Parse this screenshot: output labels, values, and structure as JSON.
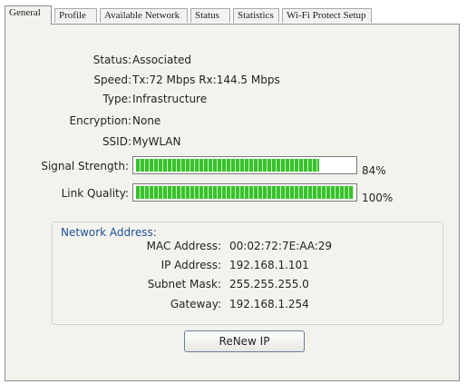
{
  "tabs": [
    {
      "label": "General"
    },
    {
      "label": "Profile"
    },
    {
      "label": "Available Network"
    },
    {
      "label": "Status"
    },
    {
      "label": "Statistics"
    },
    {
      "label": "Wi-Fi Protect Setup"
    }
  ],
  "info": {
    "status_label": "Status:",
    "status_value": "Associated",
    "speed_label": "Speed:",
    "speed_value": "Tx:72 Mbps Rx:144.5 Mbps",
    "type_label": "Type:",
    "type_value": "Infrastructure",
    "encryption_label": "Encryption:",
    "encryption_value": "None",
    "ssid_label": "SSID:",
    "ssid_value": "MyWLAN"
  },
  "signal": {
    "label": "Signal Strength:",
    "percent_text": "84%",
    "level": 0.84
  },
  "link": {
    "label": "Link Quality:",
    "percent_text": "100%",
    "level": 1.0
  },
  "network": {
    "title": "Network Address:",
    "mac_label": "MAC Address:",
    "mac_value": "00:02:72:7E:AA:29",
    "ip_label": "IP Address:",
    "ip_value": "192.168.1.101",
    "subnet_label": "Subnet Mask:",
    "subnet_value": "255.255.255.0",
    "gateway_label": "Gateway:",
    "gateway_value": "192.168.1.254"
  },
  "renew_button": "ReNew IP",
  "colors": {
    "bar_fill": "#38c22c",
    "group_title": "#1f4f9a"
  }
}
